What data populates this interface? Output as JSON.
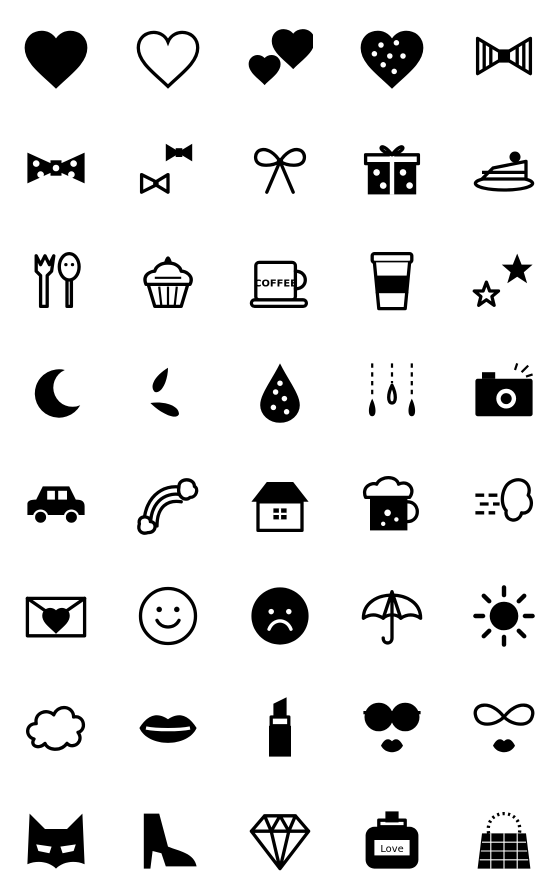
{
  "colors": {
    "ink": "#000000",
    "background": "#ffffff"
  },
  "stickers": [
    {
      "icon": "heart-filled-icon"
    },
    {
      "icon": "heart-outline-icon"
    },
    {
      "icon": "two-hearts-icon"
    },
    {
      "icon": "polka-dot-heart-icon"
    },
    {
      "icon": "striped-bow-icon"
    },
    {
      "icon": "floral-bow-icon"
    },
    {
      "icon": "two-bows-icon"
    },
    {
      "icon": "ribbon-bow-icon"
    },
    {
      "icon": "gift-box-icon"
    },
    {
      "icon": "cake-slice-icon"
    },
    {
      "icon": "fork-and-spoon-icon"
    },
    {
      "icon": "cupcake-icon"
    },
    {
      "icon": "coffee-cup-icon",
      "label": "COFFEE"
    },
    {
      "icon": "takeaway-cup-icon"
    },
    {
      "icon": "two-stars-icon"
    },
    {
      "icon": "crescent-moon-icon"
    },
    {
      "icon": "splash-drops-icon"
    },
    {
      "icon": "polka-dot-drop-icon"
    },
    {
      "icon": "hanging-drops-icon"
    },
    {
      "icon": "camera-icon"
    },
    {
      "icon": "car-icon"
    },
    {
      "icon": "rainbow-icon"
    },
    {
      "icon": "house-icon"
    },
    {
      "icon": "beer-mug-icon"
    },
    {
      "icon": "wind-puff-icon"
    },
    {
      "icon": "love-letter-icon"
    },
    {
      "icon": "smiley-face-icon"
    },
    {
      "icon": "sad-face-icon"
    },
    {
      "icon": "umbrella-icon"
    },
    {
      "icon": "sun-icon"
    },
    {
      "icon": "cloud-icon"
    },
    {
      "icon": "lips-icon"
    },
    {
      "icon": "lipstick-icon"
    },
    {
      "icon": "sunglasses-face-icon"
    },
    {
      "icon": "bow-glasses-face-icon"
    },
    {
      "icon": "cat-mask-icon"
    },
    {
      "icon": "high-heel-icon"
    },
    {
      "icon": "diamond-icon"
    },
    {
      "icon": "perfume-bottle-icon",
      "label": "Love"
    },
    {
      "icon": "handbag-icon"
    }
  ]
}
